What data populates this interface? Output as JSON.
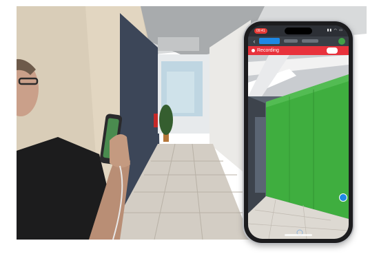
{
  "status_bar": {
    "time": "09:41",
    "icons": "▮▮ ◠ ▭"
  },
  "recording_bar": {
    "label": "Recording",
    "stop_label": ""
  },
  "navbar": {
    "back_icon": "‹"
  },
  "icons": {
    "back": "chevron-left-icon",
    "record": "record-dot-icon",
    "profile": "avatar-icon",
    "marker": "location-marker-icon"
  },
  "colors": {
    "recording_bar": "#e8323c",
    "active_tab": "#1e88e5",
    "ar_overlay": "#3fae3f",
    "profile_button": "#43a047"
  }
}
